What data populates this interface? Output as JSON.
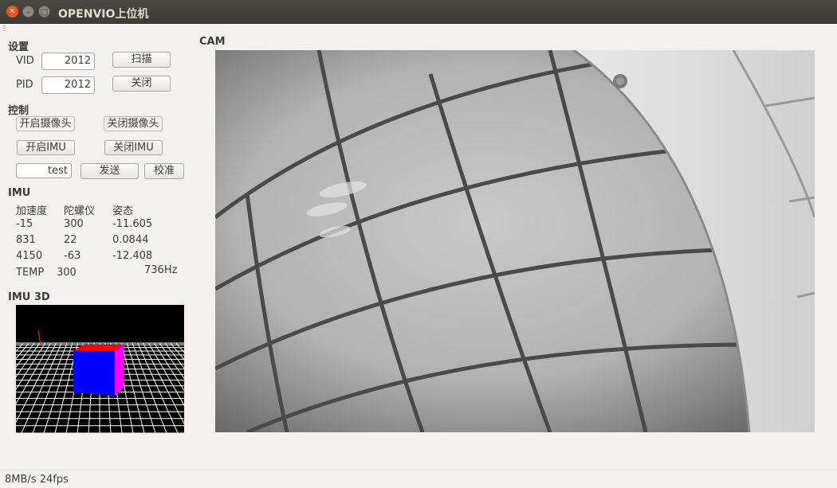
{
  "window": {
    "title": "OPENVIO上位机"
  },
  "settings": {
    "title": "设置",
    "vid_label": "VID",
    "vid_value": "2012",
    "pid_label": "PID",
    "pid_value": "2012",
    "scan_label": "扫描",
    "close_label": "关闭"
  },
  "control": {
    "title": "控制",
    "open_camera": "开启摄像头",
    "close_camera": "关闭摄像头",
    "open_imu": "开启IMU",
    "close_imu": "关闭IMU",
    "command_value": "test",
    "send_label": "发送",
    "calibrate_label": "校准"
  },
  "imu": {
    "title": "IMU",
    "headers": [
      "加速度",
      "陀螺仪",
      "姿态"
    ],
    "rows": [
      [
        "-15",
        "300",
        "-11.605"
      ],
      [
        "831",
        "22",
        "0.0844"
      ],
      [
        "4150",
        "-63",
        "-12.408"
      ]
    ],
    "temp_label": "TEMP",
    "temp_value": "300",
    "rate": "736Hz"
  },
  "imu3d": {
    "title": "IMU 3D"
  },
  "camera": {
    "title": "CAM"
  },
  "status": {
    "text": "8MB/s 24fps"
  },
  "colors": {
    "accent_close": "#e95420",
    "cube_front": "#0000ff",
    "cube_top": "#ff0000",
    "cube_side": "#ff00ff"
  }
}
